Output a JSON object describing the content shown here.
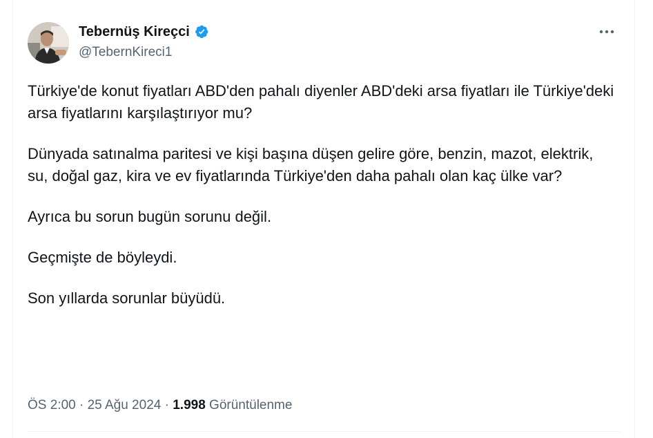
{
  "author": {
    "display_name": "Tebernüş Kireçci",
    "handle": "@TebernKireci1",
    "verified": true,
    "verified_color": "#1d9bf0"
  },
  "tweet": {
    "paragraphs": [
      "Türkiye'de konut fiyatları ABD'den pahalı diyenler ABD'deki arsa fiyatları ile Türkiye'deki arsa fiyatlarını karşılaştırıyor mu?",
      "Dünyada satınalma paritesi ve kişi başına düşen gelire göre, benzin, mazot, elektrik, su, doğal gaz, kira ve ev fiyatlarında Türkiye'den daha pahalı olan kaç ülke var?",
      "Ayrıca bu sorun bugün sorunu değil.",
      "Geçmişte de böyleydi.",
      "Son yıllarda sorunlar büyüdü."
    ]
  },
  "meta": {
    "time": "ÖS 2:00",
    "separator": " · ",
    "date": "25 Ağu 2024",
    "views_count": "1.998",
    "views_label": "Görüntülenme"
  },
  "icons": {
    "more": "more-horizontal-icon",
    "verified": "verified-badge-icon"
  },
  "colors": {
    "text_primary": "#0f1419",
    "text_secondary": "#536471",
    "border": "#eff3f4"
  }
}
